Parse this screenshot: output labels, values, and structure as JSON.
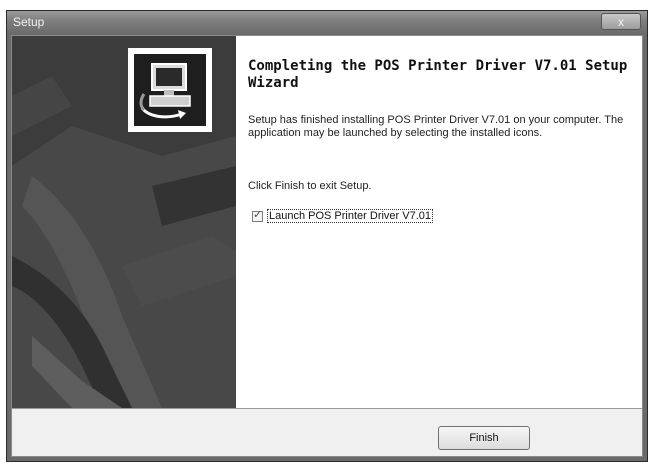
{
  "window": {
    "title": "Setup",
    "close_label": "x"
  },
  "sidebar": {
    "logo_icon": "computer-install-icon"
  },
  "content": {
    "heading": "Completing the POS Printer Driver V7.01 Setup Wizard",
    "description": "Setup has finished installing POS Printer Driver V7.01 on your computer. The application may be launched by selecting the installed icons.",
    "exit_text": "Click Finish to exit Setup.",
    "launch_checkbox": {
      "label": "Launch POS Printer Driver V7.01",
      "checked": true
    }
  },
  "footer": {
    "finish_label": "Finish"
  }
}
